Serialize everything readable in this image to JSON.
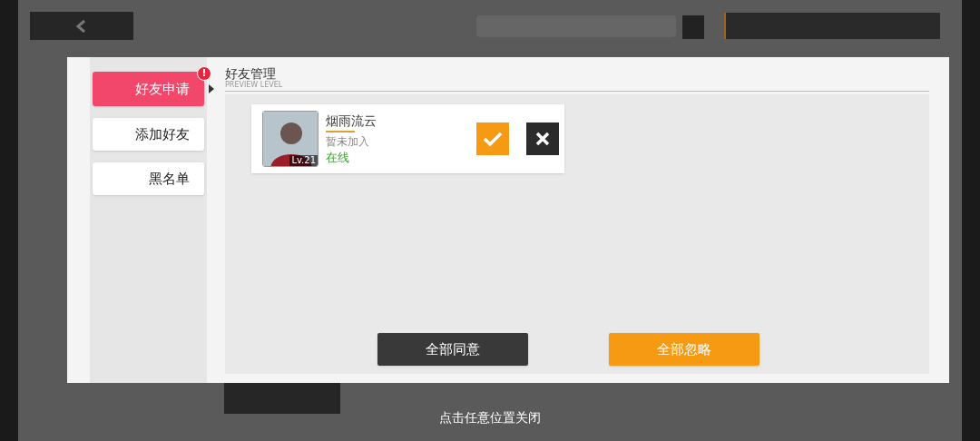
{
  "tabs": [
    {
      "label": "好友申请",
      "selected": true,
      "badge": "!"
    },
    {
      "label": "添加好友",
      "selected": false
    },
    {
      "label": "黑名单",
      "selected": false
    }
  ],
  "header": {
    "title": "好友管理",
    "subtitle": "PREVIEW LEVEL"
  },
  "requests": [
    {
      "name": "烟雨流云",
      "lv_tag": "Lv.21",
      "guild": "暂未加入",
      "status": "在线",
      "online": true
    }
  ],
  "actions": [
    {
      "label": "全部同意",
      "kind": "dark"
    },
    {
      "label": "全部忽略",
      "kind": "orange"
    }
  ],
  "footer": "点击任意位置关闭"
}
